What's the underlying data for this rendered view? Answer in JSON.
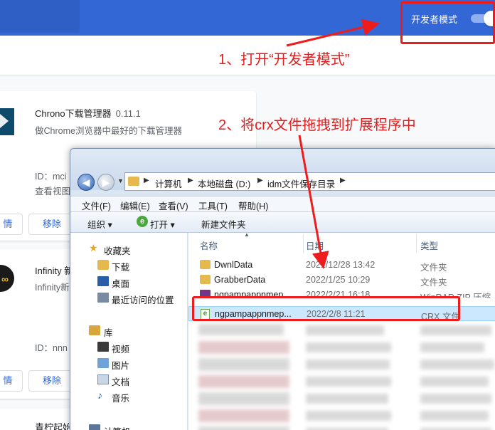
{
  "header": {
    "dev_mode_label": "开发者模式",
    "dev_mode_on": true
  },
  "extensions": [
    {
      "name": "Chrono下载管理器",
      "version": "0.11.1",
      "description": "做Chrome浏览器中最好的下载管理器",
      "id": "ID：mci",
      "view": "查看视图",
      "details_btn": "情",
      "remove_btn": "移除"
    },
    {
      "name": "Infinity 新",
      "description": "Infinity新",
      "id": "ID：nnn",
      "details_btn": "情",
      "remove_btn": "移除"
    },
    {
      "name": "青柠起始"
    }
  ],
  "explorer": {
    "breadcrumb": [
      "计算机",
      "本地磁盘 (D:)",
      "idm文件保存目录"
    ],
    "menu": [
      "文件(F)",
      "编辑(E)",
      "查看(V)",
      "工具(T)",
      "帮助(H)"
    ],
    "toolbar": {
      "organize": "组织 ▾",
      "open": "打开 ▾",
      "new_folder": "新建文件夹"
    },
    "nav": {
      "favorites": "收藏夹",
      "downloads": "下载",
      "desktop": "桌面",
      "recent": "最近访问的位置",
      "library": "库",
      "videos": "视频",
      "pictures": "图片",
      "documents": "文档",
      "music": "音乐",
      "computer": "计算机"
    },
    "columns": {
      "name": "名称",
      "date": "日期",
      "type": "类型"
    },
    "files": [
      {
        "name": "DwnlData",
        "date": "2021/12/28 13:42",
        "type": "文件夹",
        "icon": "folder-icon"
      },
      {
        "name": "GrabberData",
        "date": "2022/1/25 10:29",
        "type": "文件夹",
        "icon": "folder-icon"
      },
      {
        "name": "ngpampappnmep...",
        "date": "2022/2/21 16:18",
        "type": "WinRAR ZIP 压缩...",
        "icon": "winrar-icon"
      },
      {
        "name": "ngpampappnmep...",
        "date": "2022/2/8 11:21",
        "type": "CRX 文件",
        "icon": "crx-file-icon",
        "selected": true
      }
    ]
  },
  "annotations": {
    "step1": "1、打开“开发者模式”",
    "step2": "2、将crx文件拖拽到扩展程序中",
    "color": "#ee1c1c"
  }
}
